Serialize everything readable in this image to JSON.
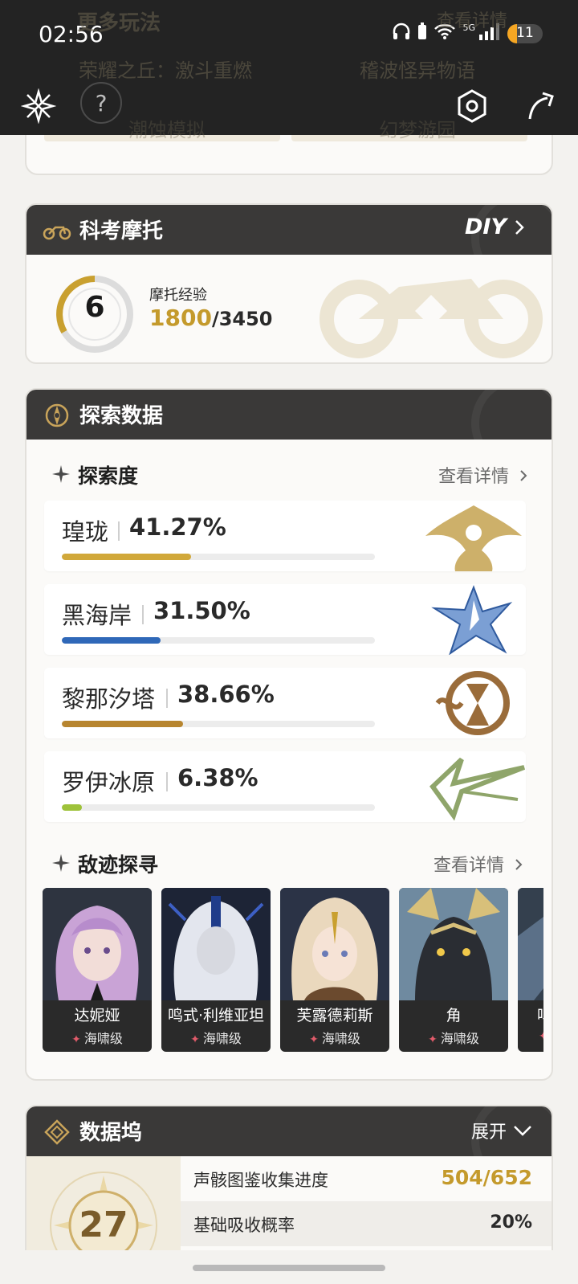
{
  "status_bar": {
    "time": "02:56",
    "network": "5G",
    "battery": "11"
  },
  "toolbar": {
    "help_label": "?"
  },
  "more_play": {
    "title": "更多玩法",
    "link": "查看详情",
    "items": [
      "荣耀之丘：激斗重燃",
      "稽波怪异物语",
      "潮蚀模拟",
      "幻梦游园"
    ]
  },
  "motorcycle": {
    "title": "科考摩托",
    "diy_label": "DIY",
    "level": "6",
    "exp_label": "摩托经验",
    "exp_current": "1800",
    "exp_total": "/3450"
  },
  "exploration": {
    "title": "探索数据",
    "degree": {
      "title": "探索度",
      "link": "查看详情",
      "regions": [
        {
          "name": "瑝珑",
          "percent": "41.27%",
          "value": 41.27,
          "color": "#d1a83a"
        },
        {
          "name": "黑海岸",
          "percent": "31.50%",
          "value": 31.5,
          "color": "#2f68b8"
        },
        {
          "name": "黎那汐塔",
          "percent": "38.66%",
          "value": 38.66,
          "color": "#b7852f"
        },
        {
          "name": "罗伊冰原",
          "percent": "6.38%",
          "value": 6.38,
          "color": "#9ec23a"
        }
      ]
    },
    "enemy": {
      "title": "敌迹探寻",
      "link": "查看详情",
      "cards": [
        {
          "name": "达妮娅",
          "rank": "海啸级"
        },
        {
          "name": "鸣式·利维亚坦",
          "rank": "海啸级"
        },
        {
          "name": "芙露德莉斯",
          "rank": "海啸级"
        },
        {
          "name": "角",
          "rank": "海啸级"
        },
        {
          "name": "鸣",
          "rank": ""
        }
      ]
    }
  },
  "data_dock": {
    "title": "数据坞",
    "expand_label": "展开",
    "level": "27",
    "rows": [
      {
        "label": "声骸图鉴收集进度",
        "value": "504/652"
      },
      {
        "label": "基础吸收概率",
        "value": "20%"
      }
    ]
  },
  "colors": {
    "accent_gold": "#c49a2c",
    "header_bg": "#3a3938",
    "page_bg": "#f3f2ef"
  }
}
